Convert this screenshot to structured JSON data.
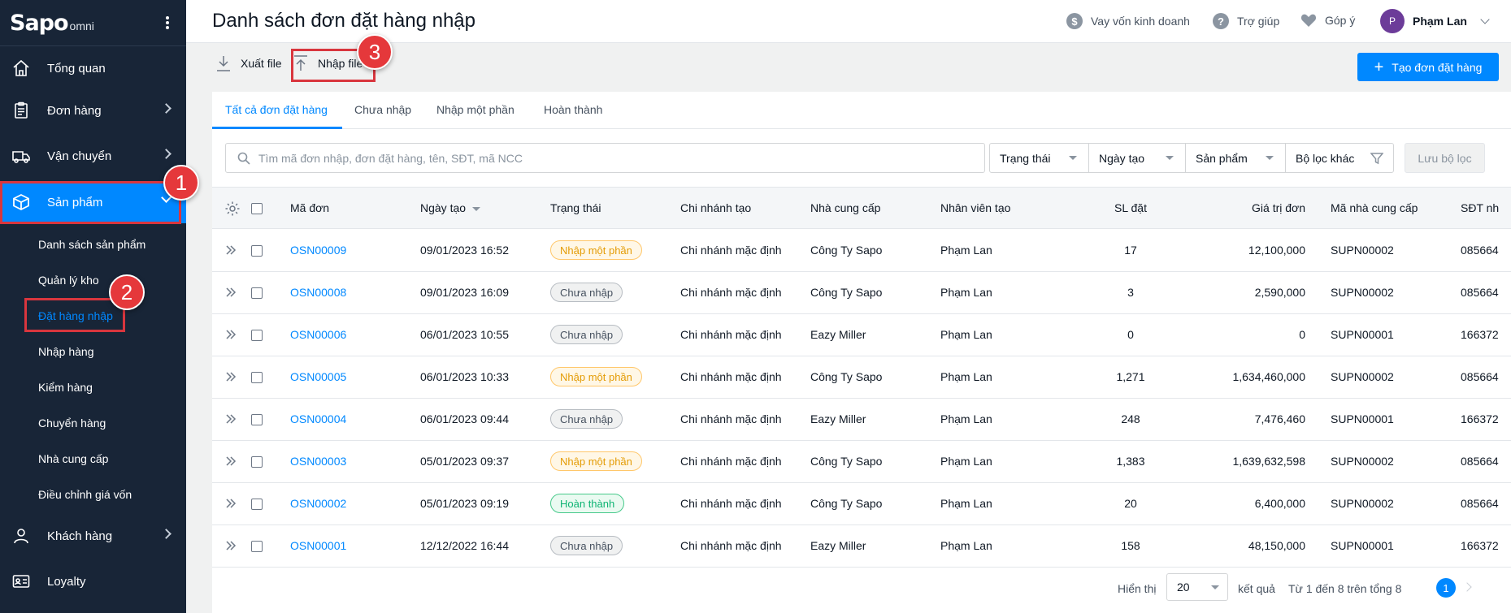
{
  "sidebar": {
    "logo_brand": "Sapo",
    "logo_suffix": "omni",
    "items": [
      {
        "label": "Tổng quan",
        "icon": "home-icon"
      },
      {
        "label": "Đơn hàng",
        "icon": "clipboard-icon"
      },
      {
        "label": "Vận chuyển",
        "icon": "truck-icon"
      },
      {
        "label": "Sản phẩm",
        "icon": "box-icon"
      },
      {
        "label": "Khách hàng",
        "icon": "person-icon"
      },
      {
        "label": "Loyalty",
        "icon": "card-icon"
      }
    ],
    "sub_items": [
      "Danh sách sản phẩm",
      "Quản lý kho",
      "Đặt hàng nhập",
      "Nhập hàng",
      "Kiểm hàng",
      "Chuyển hàng",
      "Nhà cung cấp",
      "Điều chỉnh giá vốn"
    ]
  },
  "steps": [
    "1",
    "2",
    "3"
  ],
  "header": {
    "title": "Danh sách đơn đặt hàng nhập",
    "loan": "Vay vốn kinh doanh",
    "help": "Trợ giúp",
    "feedback": "Góp ý",
    "avatar_initial": "P",
    "user": "Phạm Lan"
  },
  "actions": {
    "export": "Xuất file",
    "import": "Nhập file",
    "create": "Tạo đơn đặt hàng"
  },
  "tabs": [
    "Tất cả đơn đặt hàng",
    "Chưa nhập",
    "Nhập một phần",
    "Hoàn thành"
  ],
  "search": {
    "placeholder": "Tìm mã đơn nhập, đơn đặt hàng, tên, SĐT, mã NCC"
  },
  "filters": [
    "Trạng thái",
    "Ngày tạo",
    "Sản phẩm",
    "Bộ lọc khác"
  ],
  "save_filter": "Lưu bộ lọc",
  "table": {
    "headers": [
      "Mã đơn",
      "Ngày tạo",
      "Trạng thái",
      "Chi nhánh tạo",
      "Nhà cung cấp",
      "Nhân viên tạo",
      "SL đặt",
      "Giá trị đơn",
      "Mã nhà cung cấp",
      "SĐT nh"
    ],
    "rows": [
      {
        "code": "OSN00009",
        "date": "09/01/2023 16:52",
        "status": "Nhập một phần",
        "status_type": "partial",
        "branch": "Chi nhánh mặc định",
        "supplier": "Công Ty Sapo",
        "staff": "Phạm Lan",
        "qty": "17",
        "value": "12,100,000",
        "supplier_code": "SUPN00002",
        "phone": "085664"
      },
      {
        "code": "OSN00008",
        "date": "09/01/2023 16:09",
        "status": "Chưa nhập",
        "status_type": "none",
        "branch": "Chi nhánh mặc định",
        "supplier": "Công Ty Sapo",
        "staff": "Phạm Lan",
        "qty": "3",
        "value": "2,590,000",
        "supplier_code": "SUPN00002",
        "phone": "085664"
      },
      {
        "code": "OSN00006",
        "date": "06/01/2023 10:55",
        "status": "Chưa nhập",
        "status_type": "none",
        "branch": "Chi nhánh mặc định",
        "supplier": "Eazy Miller",
        "staff": "Phạm Lan",
        "qty": "0",
        "value": "0",
        "supplier_code": "SUPN00001",
        "phone": "166372"
      },
      {
        "code": "OSN00005",
        "date": "06/01/2023 10:33",
        "status": "Nhập một phần",
        "status_type": "partial",
        "branch": "Chi nhánh mặc định",
        "supplier": "Công Ty Sapo",
        "staff": "Phạm Lan",
        "qty": "1,271",
        "value": "1,634,460,000",
        "supplier_code": "SUPN00002",
        "phone": "085664"
      },
      {
        "code": "OSN00004",
        "date": "06/01/2023 09:44",
        "status": "Chưa nhập",
        "status_type": "none",
        "branch": "Chi nhánh mặc định",
        "supplier": "Eazy Miller",
        "staff": "Phạm Lan",
        "qty": "248",
        "value": "7,476,460",
        "supplier_code": "SUPN00001",
        "phone": "166372"
      },
      {
        "code": "OSN00003",
        "date": "05/01/2023 09:37",
        "status": "Nhập một phần",
        "status_type": "partial",
        "branch": "Chi nhánh mặc định",
        "supplier": "Công Ty Sapo",
        "staff": "Phạm Lan",
        "qty": "1,383",
        "value": "1,639,632,598",
        "supplier_code": "SUPN00002",
        "phone": "085664"
      },
      {
        "code": "OSN00002",
        "date": "05/01/2023 09:19",
        "status": "Hoàn thành",
        "status_type": "done",
        "branch": "Chi nhánh mặc định",
        "supplier": "Công Ty Sapo",
        "staff": "Phạm Lan",
        "qty": "20",
        "value": "6,400,000",
        "supplier_code": "SUPN00002",
        "phone": "085664"
      },
      {
        "code": "OSN00001",
        "date": "12/12/2022 16:44",
        "status": "Chưa nhập",
        "status_type": "none",
        "branch": "Chi nhánh mặc định",
        "supplier": "Eazy Miller",
        "staff": "Phạm Lan",
        "qty": "158",
        "value": "48,150,000",
        "supplier_code": "SUPN00001",
        "phone": "166372"
      }
    ]
  },
  "footer": {
    "show_label": "Hiển thị",
    "page_size": "20",
    "results_label": "kết quả",
    "range_text": "Từ 1 đến 8 trên tổng 8",
    "current_page": "1"
  },
  "colors": {
    "sidebar_bg": "#182537",
    "accent": "#0088ff",
    "annotation_red": "#e5383b"
  }
}
